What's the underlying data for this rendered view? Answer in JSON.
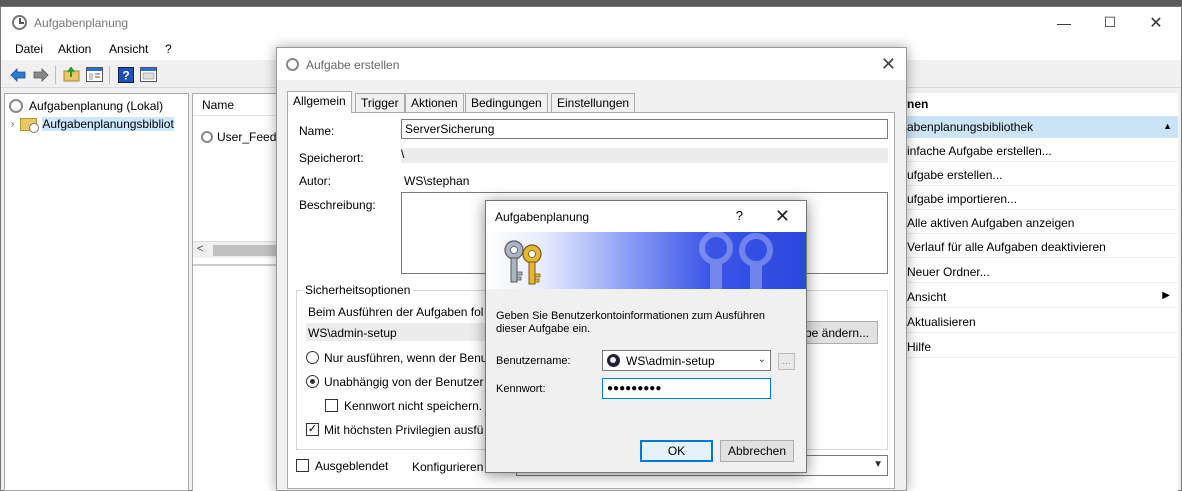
{
  "main_window": {
    "title": "Aufgabenplanung",
    "controls": {
      "minimize": "—",
      "maximize": "☐",
      "close": "✕"
    }
  },
  "menu": [
    "Datei",
    "Aktion",
    "Ansicht",
    "?"
  ],
  "toolbar_icons": [
    "back-arrow-icon",
    "forward-arrow-icon",
    "folder-up-icon",
    "show-hide-tree-icon",
    "help-icon",
    "properties-icon"
  ],
  "tree": {
    "root": "Aufgabenplanung (Lokal)",
    "child": "Aufgabenplanungsbibliot"
  },
  "list": {
    "header": "Name",
    "rows": [
      "User_Feed_"
    ]
  },
  "actions": {
    "header": "nen",
    "section": "abenplanungsbibliothek",
    "items": [
      "infache Aufgabe erstellen...",
      "ufgabe erstellen...",
      "ufgabe importieren...",
      "Alle aktiven Aufgaben anzeigen",
      "Verlauf für alle Aufgaben deaktivieren",
      "Neuer Ordner...",
      "Ansicht",
      "Aktualisieren",
      "Hilfe"
    ]
  },
  "create_task": {
    "title": "Aufgabe erstellen",
    "tabs": [
      "Allgemein",
      "Trigger",
      "Aktionen",
      "Bedingungen",
      "Einstellungen"
    ],
    "name_label": "Name:",
    "name_value": "ServerSicherung",
    "location_label": "Speicherort:",
    "location_value": "\\",
    "author_label": "Autor:",
    "author_value": "WS\\stephan",
    "description_label": "Beschreibung:",
    "security_title": "Sicherheitsoptionen",
    "security_run_as": "Beim Ausführen der Aufgaben fol",
    "security_user": "WS\\admin-setup",
    "change_button": "be ändern...",
    "radio_logged_on": "Nur ausführen, wenn der Benu",
    "radio_independent": "Unabhängig von der Benutzer",
    "check_no_password": "Kennwort nicht speichern.",
    "check_highest": "Mit höchsten Privilegien ausfü",
    "check_hidden": "Ausgeblendet",
    "configure_label": "Konfigurieren für"
  },
  "credentials": {
    "title": "Aufgabenplanung",
    "help": "?",
    "close": "✕",
    "message": "Geben Sie Benutzerkontoinformationen zum Ausführen dieser Aufgabe ein.",
    "username_label": "Benutzername:",
    "username_value": "WS\\admin-setup",
    "password_label": "Kennwort:",
    "password_value": "●●●●●●●●●",
    "ok": "OK",
    "cancel": "Abbrechen"
  }
}
